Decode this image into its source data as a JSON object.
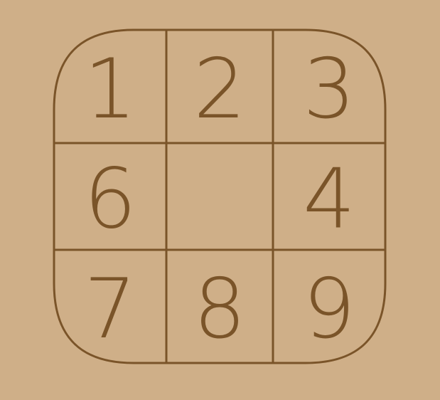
{
  "colors": {
    "background": "#CFAF88",
    "ink": "#7A5429"
  },
  "board": {
    "rows": 3,
    "cols": 3,
    "cells": [
      {
        "value": "1",
        "empty": false
      },
      {
        "value": "2",
        "empty": false
      },
      {
        "value": "3",
        "empty": false
      },
      {
        "value": "6",
        "empty": false
      },
      {
        "value": "",
        "empty": true
      },
      {
        "value": "4",
        "empty": false
      },
      {
        "value": "7",
        "empty": false
      },
      {
        "value": "8",
        "empty": false
      },
      {
        "value": "9",
        "empty": false
      }
    ]
  }
}
